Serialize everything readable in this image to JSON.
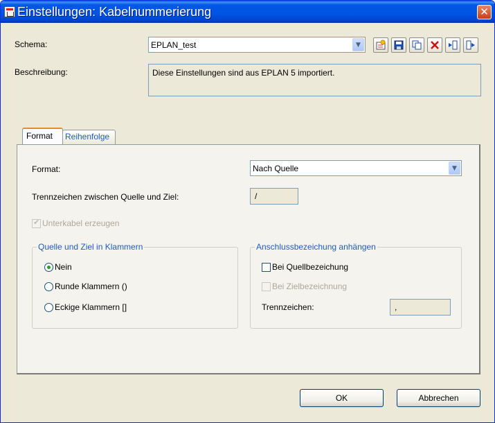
{
  "window": {
    "title": "Einstellungen: Kabelnummerierung",
    "close_glyph": "✕"
  },
  "schema": {
    "label": "Schema:",
    "value": "EPLAN_test",
    "toolbar_icons": [
      "new-icon",
      "save-icon",
      "copy-icon",
      "delete-icon",
      "import-icon",
      "export-icon"
    ]
  },
  "description": {
    "label": "Beschreibung:",
    "value": "Diese Einstellungen sind aus EPLAN 5 importiert."
  },
  "tabs": [
    {
      "label": "Format",
      "active": true
    },
    {
      "label": "Reihenfolge",
      "active": false
    }
  ],
  "format": {
    "format_label": "Format:",
    "format_value": "Nach Quelle",
    "separator_label": "Trennzeichen zwischen Quelle und Ziel:",
    "separator_value": "/",
    "subcable_label": "Unterkabel erzeugen",
    "subcable_checked": true
  },
  "brackets_group": {
    "title": "Quelle und Ziel in Klammern",
    "options": [
      {
        "label": "Nein",
        "selected": true
      },
      {
        "label": "Runde Klammern ()",
        "selected": false
      },
      {
        "label": "Eckige Klammern []",
        "selected": false
      }
    ]
  },
  "connection_group": {
    "title": "Anschlussbezeichung anhängen",
    "source_label": "Bei Quellbezeichung",
    "target_label": "Bei Zielbezeichnung",
    "separator_label": "Trennzeichen:",
    "separator_value": ","
  },
  "buttons": {
    "ok": "OK",
    "cancel": "Abbrechen"
  },
  "colors": {
    "titlebar": "#0054e3",
    "window_bg": "#ece9d8",
    "group_title": "#1c5cc2"
  }
}
